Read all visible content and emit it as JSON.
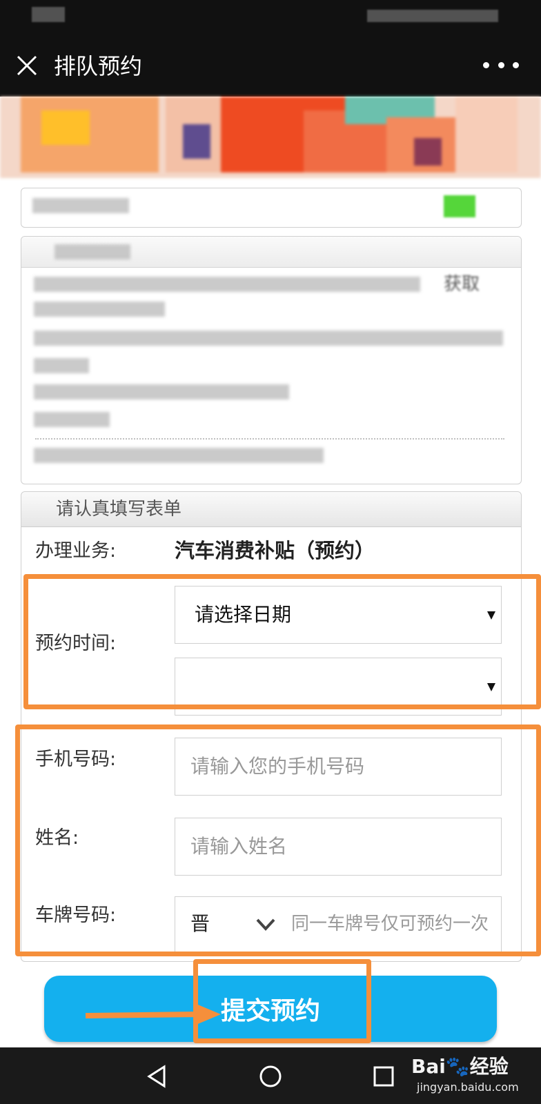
{
  "header": {
    "title": "排队预约"
  },
  "form": {
    "section_title": "请认真填写表单",
    "business_label": "办理业务:",
    "business_value": "汽车消费补贴（预约）",
    "time_label": "预约时间:",
    "date_select_value": "请选择日期",
    "time_select_value": "",
    "phone_label": "手机号码:",
    "phone_placeholder": "请输入您的手机号码",
    "name_label": "姓名:",
    "name_placeholder": "请输入姓名",
    "plate_label": "车牌号码:",
    "plate_prefix": "晋",
    "plate_placeholder": "同一车牌号仅可预约一次",
    "submit_label": "提交预约"
  },
  "notice": {
    "partial_text": "获取"
  },
  "watermark": {
    "brand": "Bai",
    "brand_suffix": "经验",
    "url": "jingyan.baidu.com"
  },
  "colors": {
    "accent_blue": "#14b0ee",
    "annotation_orange": "#f58f3b",
    "bar_dark": "#111111"
  },
  "icons": [
    "close-icon",
    "more-icon",
    "dropdown-arrow-icon",
    "chevron-down-icon",
    "back-nav-icon",
    "home-nav-icon",
    "recents-nav-icon",
    "annotation-arrow-icon"
  ]
}
